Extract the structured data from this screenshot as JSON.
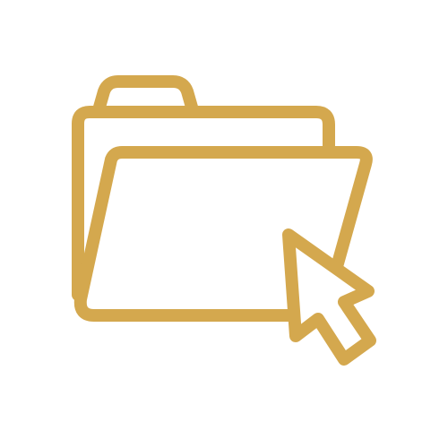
{
  "icon": {
    "name": "open-folder-with-cursor",
    "parts": [
      "folder-icon",
      "cursor-arrow-icon"
    ],
    "color": "#D4A84E",
    "background": "#FFFFFF"
  }
}
